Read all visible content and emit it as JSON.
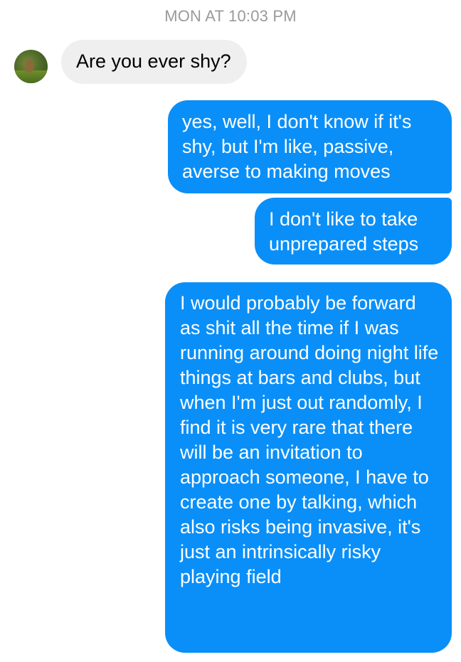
{
  "conversation": {
    "timestamp": "MON AT 10:03 PM",
    "messages": [
      {
        "sender": "contact",
        "text": "Are you ever shy?"
      },
      {
        "sender": "me",
        "text": "yes, well, I don't know if it's shy, but I'm like, passive, averse to making moves"
      },
      {
        "sender": "me",
        "text": "I don't like to take unprepared steps"
      },
      {
        "sender": "me",
        "text": "I would probably be forward as shit all the time if I was running around doing night life things at bars and clubs, but when I'm just out randomly, I find it is very rare that there will be an invitation to approach someone, I have to create one by talking, which also risks being invasive, it's just an intrinsically risky playing field"
      }
    ]
  },
  "colors": {
    "outgoing_bubble": "#0a8ff8",
    "incoming_bubble": "#efefef",
    "timestamp_text": "#9a9a9a"
  },
  "icons": {
    "contact_avatar": "avatar"
  }
}
